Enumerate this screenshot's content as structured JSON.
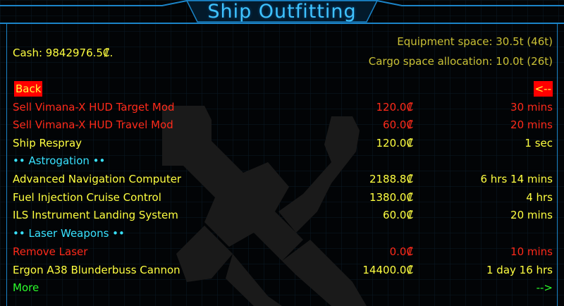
{
  "title": "Ship Outfitting",
  "cash": "Cash: 9842976.5₡.",
  "equipment_space": "Equipment space: 30.5t (46t)",
  "cargo_space": "Cargo space allocation: 10.0t (26t)",
  "back": {
    "label": "Back",
    "arrow": "<--"
  },
  "rows": [
    {
      "name": "Sell Vimana-X HUD Target Mod",
      "price": "120.0₡",
      "time": "30 mins",
      "color": "#ff2a1a"
    },
    {
      "name": "Sell Vimana-X HUD Travel Mod",
      "price": "60.0₡",
      "time": "20 mins",
      "color": "#ff2a1a"
    },
    {
      "name": "Ship Respray",
      "price": "120.0₡",
      "time": "1 sec",
      "color": "#ffff40"
    }
  ],
  "section_astrogation": "•• Astrogation ••",
  "astro_rows": [
    {
      "name": "Advanced Navigation Computer",
      "price": "2188.8₡",
      "time": "6 hrs 14 mins"
    },
    {
      "name": "Fuel Injection Cruise Control",
      "price": "1380.0₡",
      "time": "4 hrs"
    },
    {
      "name": "ILS Instrument Landing System",
      "price": "60.0₡",
      "time": "20 mins"
    }
  ],
  "section_laser": "•• Laser Weapons ••",
  "laser_rows": [
    {
      "name": "Remove Laser",
      "price": "0.0₡",
      "time": "10 mins",
      "color": "#ff2a1a"
    },
    {
      "name": "Ergon A38 Blunderbuss Cannon",
      "price": "14400.0₡",
      "time": "1 day 16 hrs",
      "color": "#ffff40"
    }
  ],
  "more": {
    "label": "More",
    "arrow": "-->"
  },
  "colors": {
    "title": "#3fc3ff",
    "frame": "#1b84c8",
    "text": "#ffff40",
    "remove": "#ff2a1a",
    "section": "#38e2ff",
    "more": "#2cff2c"
  },
  "icons": [
    "tools-background-icon"
  ]
}
